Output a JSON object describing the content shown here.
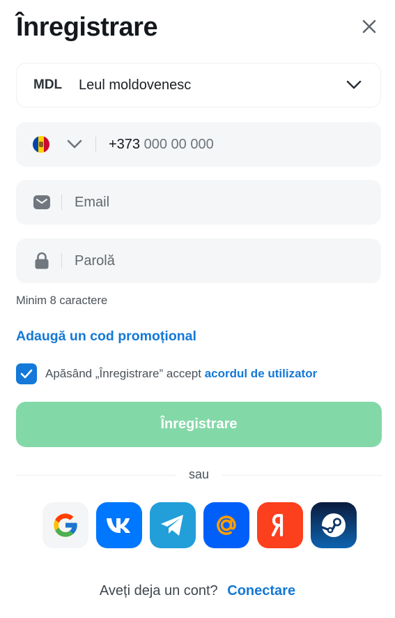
{
  "header": {
    "title": "Înregistrare"
  },
  "currency": {
    "code": "MDL",
    "name": "Leul moldovenesc"
  },
  "phone": {
    "prefix": "+373",
    "placeholder": "000 00 000"
  },
  "email": {
    "placeholder": "Email"
  },
  "password": {
    "placeholder": "Parolă",
    "hint": "Minim 8 caractere"
  },
  "promo": {
    "label": "Adaugă un cod promoțional"
  },
  "agreement": {
    "checked": true,
    "text": "Apăsând „Înregistrare” accept",
    "link": "acordul de utilizator"
  },
  "submit": {
    "label": "Înregistrare",
    "color": "#83d8a8"
  },
  "divider": {
    "label": "sau"
  },
  "social": [
    {
      "name": "google-icon"
    },
    {
      "name": "vk-icon",
      "color": "#0077ff"
    },
    {
      "name": "telegram-icon",
      "color": "#229ed9"
    },
    {
      "name": "mail-ru-icon",
      "color": "#005ff9"
    },
    {
      "name": "yandex-icon",
      "color": "#fc3f1d"
    },
    {
      "name": "steam-icon",
      "color": "#0d3163"
    }
  ],
  "footer": {
    "text": "Aveți deja un cont?",
    "link": "Conectare"
  },
  "colors": {
    "accent": "#1478d6",
    "checkbox": "#1479d8"
  }
}
